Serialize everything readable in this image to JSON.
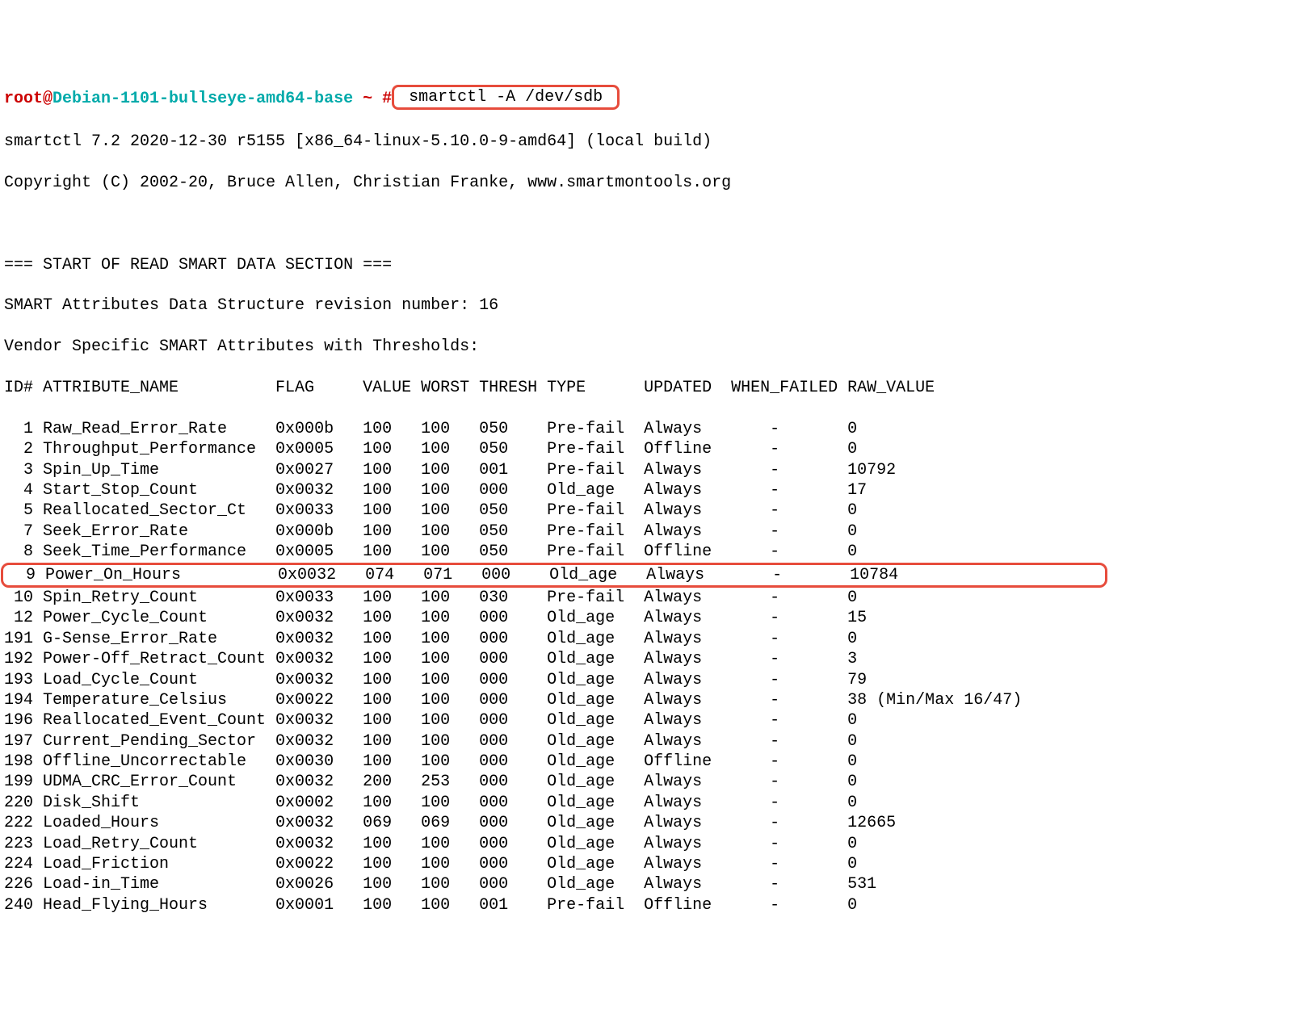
{
  "prompt": {
    "user": "root",
    "at": "@",
    "host": "Debian-1101-bullseye-amd64-base",
    "path": " ~ ",
    "hash": "#",
    "command": " smartctl -A /dev/sdb "
  },
  "header": {
    "version_line": "smartctl 7.2 2020-12-30 r5155 [x86_64-linux-5.10.0-9-amd64] (local build)",
    "copyright_line": "Copyright (C) 2002-20, Bruce Allen, Christian Franke, www.smartmontools.org"
  },
  "section": {
    "title": "=== START OF READ SMART DATA SECTION ===",
    "revision": "SMART Attributes Data Structure revision number: 16",
    "vendor": "Vendor Specific SMART Attributes with Thresholds:"
  },
  "columns": "ID# ATTRIBUTE_NAME          FLAG     VALUE WORST THRESH TYPE      UPDATED  WHEN_FAILED RAW_VALUE",
  "rows": [
    "  1 Raw_Read_Error_Rate     0x000b   100   100   050    Pre-fail  Always       -       0",
    "  2 Throughput_Performance  0x0005   100   100   050    Pre-fail  Offline      -       0",
    "  3 Spin_Up_Time            0x0027   100   100   001    Pre-fail  Always       -       10792",
    "  4 Start_Stop_Count        0x0032   100   100   000    Old_age   Always       -       17",
    "  5 Reallocated_Sector_Ct   0x0033   100   100   050    Pre-fail  Always       -       0",
    "  7 Seek_Error_Rate         0x000b   100   100   050    Pre-fail  Always       -       0",
    "  8 Seek_Time_Performance   0x0005   100   100   050    Pre-fail  Offline      -       0",
    "  9 Power_On_Hours          0x0032   074   071   000    Old_age   Always       -       10784                     ",
    " 10 Spin_Retry_Count        0x0033   100   100   030    Pre-fail  Always       -       0",
    " 12 Power_Cycle_Count       0x0032   100   100   000    Old_age   Always       -       15",
    "191 G-Sense_Error_Rate      0x0032   100   100   000    Old_age   Always       -       0",
    "192 Power-Off_Retract_Count 0x0032   100   100   000    Old_age   Always       -       3",
    "193 Load_Cycle_Count        0x0032   100   100   000    Old_age   Always       -       79",
    "194 Temperature_Celsius     0x0022   100   100   000    Old_age   Always       -       38 (Min/Max 16/47)",
    "196 Reallocated_Event_Count 0x0032   100   100   000    Old_age   Always       -       0",
    "197 Current_Pending_Sector  0x0032   100   100   000    Old_age   Always       -       0",
    "198 Offline_Uncorrectable   0x0030   100   100   000    Old_age   Offline      -       0",
    "199 UDMA_CRC_Error_Count    0x0032   200   253   000    Old_age   Always       -       0",
    "220 Disk_Shift              0x0002   100   100   000    Old_age   Always       -       0",
    "222 Loaded_Hours            0x0032   069   069   000    Old_age   Always       -       12665",
    "223 Load_Retry_Count        0x0032   100   100   000    Old_age   Always       -       0",
    "224 Load_Friction           0x0022   100   100   000    Old_age   Always       -       0",
    "226 Load-in_Time            0x0026   100   100   000    Old_age   Always       -       531",
    "240 Head_Flying_Hours       0x0001   100   100   001    Pre-fail  Offline      -       0"
  ],
  "highlight_row_index": 7
}
